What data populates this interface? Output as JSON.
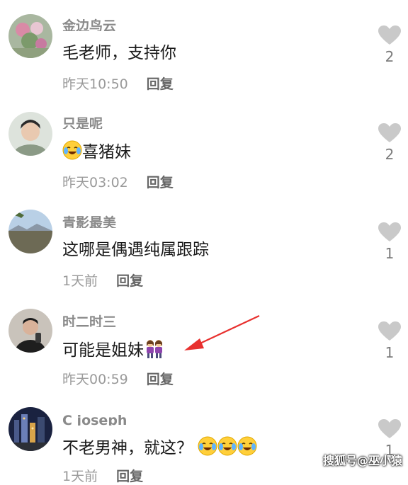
{
  "colors": {
    "arrow": "#e8302e",
    "like_icon": "#c9c9c9",
    "text": "#1a1a1a",
    "meta": "#9a9a9a"
  },
  "comments": [
    {
      "username": "金边鸟云",
      "text": "毛老师，支持你",
      "time": "昨天10:50",
      "reply": "回复",
      "likes": "2",
      "avatar": "flowers-avatar"
    },
    {
      "username": "只是呢",
      "text": "喜猪妹",
      "emoji": "crying-laughing-emoji",
      "time": "昨天03:02",
      "reply": "回复",
      "likes": "2",
      "avatar": "young-man-avatar"
    },
    {
      "username": "青影最美",
      "text": "这哪是偶遇纯属跟踪",
      "time": "1天前",
      "reply": "回复",
      "likes": "1",
      "avatar": "landscape-avatar"
    },
    {
      "username": "时二时三",
      "text": "可能是姐妹",
      "emoji": "two-women-emoji",
      "time": "昨天00:59",
      "reply": "回复",
      "likes": "1",
      "avatar": "selfie-man-avatar"
    },
    {
      "username": "C    joseph",
      "text": "不老男神，就这？",
      "emoji": "crying-laughing-emoji x3",
      "time": "1天前",
      "reply": "回复",
      "likes": "1",
      "avatar": "night-city-avatar"
    }
  ],
  "watermark": "搜狐号@巫小猿"
}
